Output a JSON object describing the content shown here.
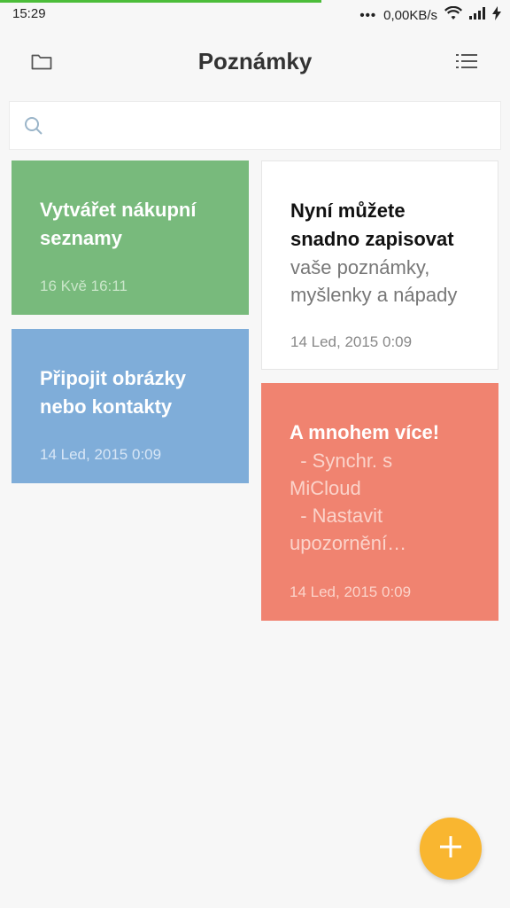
{
  "status_bar": {
    "time": "15:29",
    "dots": "•••",
    "network_speed": "0,00KB/s",
    "progress_fraction": 0.63
  },
  "header": {
    "title": "Poznámky",
    "left_icon": "folder-icon",
    "right_icon": "list-menu-icon"
  },
  "search": {
    "placeholder": "",
    "value": ""
  },
  "notes": [
    {
      "title": "Vytvářet nákupní seznamy",
      "body": "",
      "date": "16 Kvě 16:11",
      "color": "#78ba7c"
    },
    {
      "title": "Připojit obrázky nebo kontakty",
      "body": "",
      "date": "14 Led, 2015 0:09",
      "color": "#7fadd9"
    },
    {
      "title": "Nyní můžete snadno zapisovat",
      "body": "vaše poznámky, myšlenky a nápady",
      "date": "14 Led, 2015 0:09",
      "color": "#ffffff"
    },
    {
      "title": "A mnohem více!",
      "body": "  - Synchr. s\nMiCloud\n  - Nastavit\nupozornění…",
      "date": "14 Led, 2015 0:09",
      "color": "#f08370"
    }
  ],
  "fab": {
    "icon": "plus-icon",
    "color": "#f9b630"
  }
}
